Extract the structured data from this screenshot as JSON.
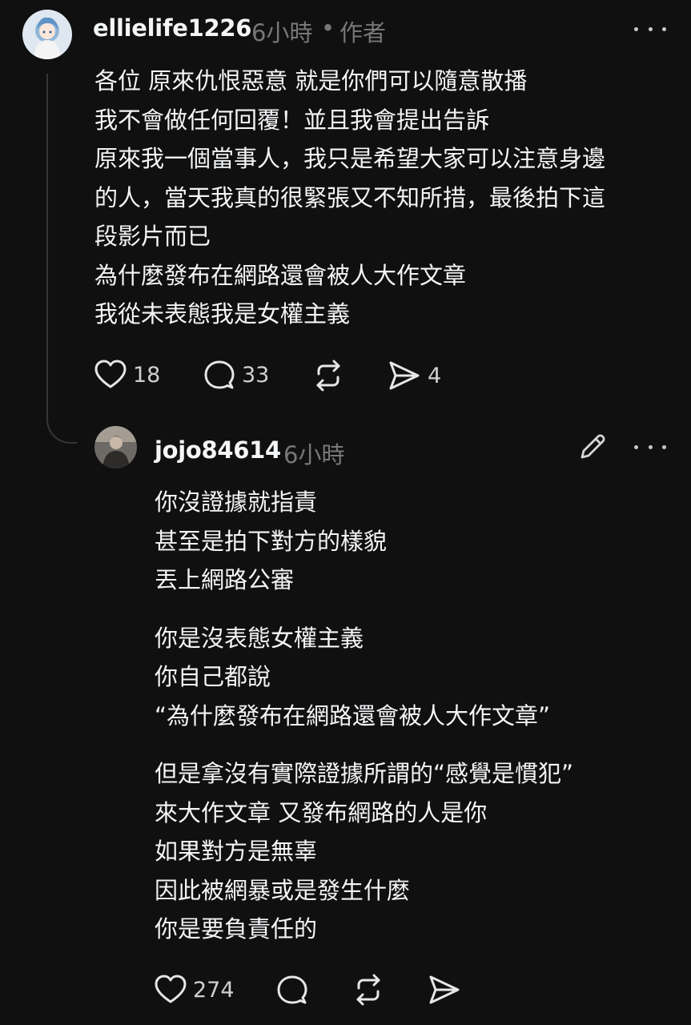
{
  "post": {
    "username": "ellielife1226",
    "time": "6小時",
    "separator": "•",
    "author_tag": "作者",
    "lines": [
      "各位 原來仇恨惡意 就是你們可以隨意散播",
      "我不會做任何回覆！並且我會提出告訴",
      "原來我一個當事人，我只是希望大家可以注意身邊",
      "的人，當天我真的很緊張又不知所措，最後拍下這",
      "段影片而已",
      "為什麼發布在網路還會被人大作文章",
      "我從未表態我是女權主義"
    ],
    "likes": "18",
    "comments": "33",
    "shares": "4",
    "icons": {
      "more": "more-horizontal-icon",
      "like": "heart-icon",
      "comment": "comment-bubble-icon",
      "repost": "repost-icon",
      "share": "send-icon"
    }
  },
  "reply": {
    "username": "jojo84614",
    "time": "6小時",
    "paragraphs": [
      [
        "你沒證據就指責",
        "甚至是拍下對方的樣貌",
        "丟上網路公審"
      ],
      [
        "你是沒表態女權主義",
        "你自己都說",
        "“為什麼發布在網路還會被人大作文章”"
      ],
      [
        "但是拿沒有實際證據所謂的“感覺是慣犯”",
        "來大作文章 又發布網路的人是你",
        "如果對方是無辜",
        "因此被網暴或是發生什麼",
        "你是要負責任的"
      ]
    ],
    "likes": "274",
    "icons": {
      "edit": "pencil-edit-icon",
      "more": "more-horizontal-icon",
      "like": "heart-icon",
      "comment": "comment-bubble-icon",
      "repost": "repost-icon",
      "share": "send-icon"
    }
  },
  "colors": {
    "background": "#101010",
    "text_primary": "#f3f5f7",
    "text_secondary": "#777777",
    "thread_line": "#333638"
  }
}
